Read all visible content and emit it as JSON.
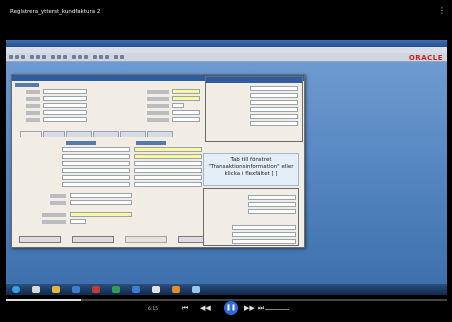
{
  "video": {
    "title": "Registrera_ytterst_kundfaktura 2",
    "menu_glyph": "⋮"
  },
  "app": {
    "brand": "ORACLE",
    "brand_color": "#cc1f1a",
    "titlebar_color": "#2e5e9f"
  },
  "form": {
    "required_field_color": "#fff79a",
    "callout_text": "Tab till fönstret\n\"Transaktionsinformation\" eller\nklicka i flexfältet [ ]"
  },
  "player": {
    "time": "6:15",
    "play_glyph": "❚❚",
    "prev_glyph": "⏮",
    "rew_glyph": "◀◀",
    "fwd_glyph": "▶▶",
    "next_glyph": "⏭",
    "progress": 0.17
  }
}
